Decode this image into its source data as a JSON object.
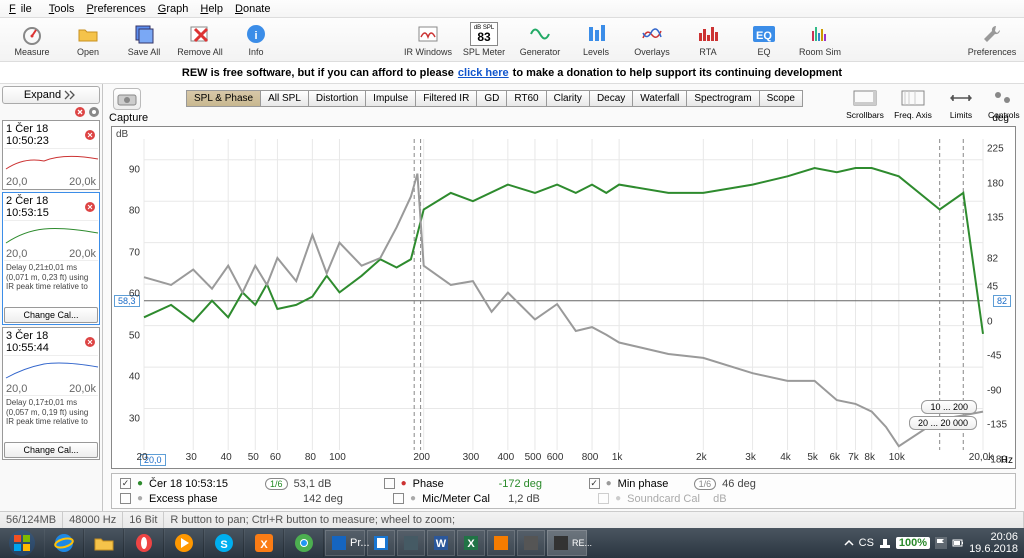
{
  "menu": {
    "file": "File",
    "tools": "Tools",
    "preferences": "Preferences",
    "graph": "Graph",
    "help": "Help",
    "donate": "Donate"
  },
  "toolbar": {
    "measure": "Measure",
    "open": "Open",
    "saveall": "Save All",
    "removeall": "Remove All",
    "info": "Info",
    "irwindows": "IR Windows",
    "splmeter": "SPL Meter",
    "splvalue": "83",
    "splunit": "dB SPL",
    "generator": "Generator",
    "levels": "Levels",
    "overlays": "Overlays",
    "rta": "RTA",
    "eq": "EQ",
    "roomsim": "Room Sim",
    "preferences": "Preferences"
  },
  "donate": {
    "pre": "REW is free software, but if you can afford to please ",
    "link": "click here",
    "post": " to make a donation to help support its continuing development"
  },
  "sidebar": {
    "expand": "Expand",
    "thumbs": [
      {
        "idx": "1",
        "title": "Čer 18 10:50:23",
        "lo": "20,0",
        "hi": "20,0k"
      },
      {
        "idx": "2",
        "title": "Čer 18 10:53:15",
        "lo": "20,0",
        "hi": "20,0k",
        "info": "Delay 0,21±0,01 ms (0,071 m, 0,23 ft)\nusing IR peak time relative to"
      },
      {
        "idx": "3",
        "title": "Čer 18 10:55:44",
        "lo": "20,0",
        "hi": "20,0k",
        "info": "Delay 0,17±0,01 ms (0,057 m, 0,19 ft)\nusing IR peak time relative to"
      }
    ],
    "changecal": "Change Cal..."
  },
  "capture": "Capture",
  "tabs": [
    "SPL & Phase",
    "All SPL",
    "Distortion",
    "Impulse",
    "Filtered IR",
    "GD",
    "RT60",
    "Clarity",
    "Decay",
    "Waterfall",
    "Spectrogram",
    "Scope"
  ],
  "viewctrls": {
    "scrollbars": "Scrollbars",
    "freqaxis": "Freq. Axis",
    "limits": "Limits",
    "controls": "Controls"
  },
  "chart_data": {
    "type": "line",
    "xlabel": "Hz",
    "ylabel": "dB",
    "y2label": "deg",
    "xscale": "log",
    "xlim": [
      20,
      20000
    ],
    "ylim": [
      20,
      95
    ],
    "y2lim": [
      -180,
      225
    ],
    "xticks": [
      20,
      30,
      40,
      50,
      60,
      80,
      100,
      200,
      300,
      400,
      500,
      600,
      800,
      1000,
      2000,
      3000,
      4000,
      5000,
      6000,
      7000,
      8000,
      10000,
      20000
    ],
    "xticklabels": [
      "20",
      "30",
      "40",
      "50",
      "60",
      "80",
      "100",
      "200",
      "300",
      "400",
      "500",
      "600",
      "800",
      "1k",
      "2k",
      "3k",
      "4k",
      "5k",
      "6k",
      "7k",
      "8k",
      "10k",
      "20,0k"
    ],
    "yticks": [
      30,
      40,
      50,
      60,
      70,
      80,
      90
    ],
    "y2ticks": [
      -180,
      -135,
      -90,
      -45,
      0,
      45,
      82,
      135,
      180,
      225
    ],
    "cursor_left": "58,3",
    "cursor_right": "82",
    "cursor_bottom": "20,0",
    "range1": "10 ... 200",
    "range2": "20 ... 20 000",
    "series": [
      {
        "name": "SPL",
        "axis": "y",
        "color": "#2e8b2e",
        "x": [
          20,
          25,
          30,
          35,
          40,
          45,
          50,
          55,
          60,
          70,
          80,
          90,
          100,
          120,
          140,
          160,
          180,
          200,
          250,
          300,
          400,
          500,
          600,
          700,
          800,
          900,
          1000,
          1500,
          2000,
          3000,
          4000,
          5000,
          6000,
          7000,
          8000,
          10000,
          14000,
          17000,
          20000
        ],
        "y": [
          52,
          55,
          51,
          56,
          52,
          58,
          55,
          60,
          54,
          55,
          57,
          62,
          58,
          62,
          66,
          64,
          66,
          78,
          82,
          80,
          84,
          82,
          84,
          82,
          84,
          82,
          84,
          82,
          82,
          84,
          86,
          88,
          87,
          88,
          88,
          86,
          78,
          82,
          48
        ]
      },
      {
        "name": "Min phase",
        "axis": "y2",
        "color": "#9a9a9a",
        "x": [
          20,
          25,
          30,
          35,
          40,
          45,
          50,
          55,
          60,
          70,
          80,
          90,
          100,
          120,
          140,
          160,
          180,
          190,
          200,
          250,
          300,
          350,
          400,
          500,
          600,
          700,
          800,
          900,
          1000,
          1500,
          2000,
          3000,
          4000,
          5000,
          6000,
          7000,
          8000,
          9000,
          10000,
          14000,
          17000,
          20000
        ],
        "y": [
          45,
          35,
          55,
          30,
          60,
          25,
          60,
          35,
          70,
          40,
          100,
          50,
          90,
          60,
          70,
          110,
          150,
          180,
          60,
          35,
          40,
          0,
          25,
          -10,
          10,
          -25,
          -20,
          -30,
          -40,
          -55,
          -60,
          -80,
          -90,
          -90,
          -115,
          -120,
          -130,
          -150,
          -175,
          -140,
          -135,
          -130
        ]
      }
    ],
    "vmarkers": [
      185,
      195,
      14000,
      17000
    ]
  },
  "legend": {
    "name": "Čer 18 10:53:15",
    "smooth": "1/6",
    "db": "53,1 dB",
    "phase": "Phase",
    "phasedeg": "-172 deg",
    "minphase": "Min phase",
    "minsmooth": "1/6",
    "mindeg": "46 deg",
    "excess": "Excess phase",
    "excessdeg": "142 deg",
    "miccal": "Mic/Meter Cal",
    "miccaldb": "1,2 dB",
    "soundcard": "Soundcard Cal",
    "sounddb": "dB"
  },
  "appstatus": {
    "mem": "56/124MB",
    "rate": "48000 Hz",
    "bit": "16 Bit",
    "hint": "R button to pan; Ctrl+R button to measure; wheel to zoom;"
  },
  "taskbar": {
    "tasks": [
      "Pr...",
      "",
      "",
      "",
      "",
      "",
      ""
    ],
    "lang": "CS",
    "vol": "100%",
    "time": "20:06",
    "date": "19.6.2018"
  }
}
